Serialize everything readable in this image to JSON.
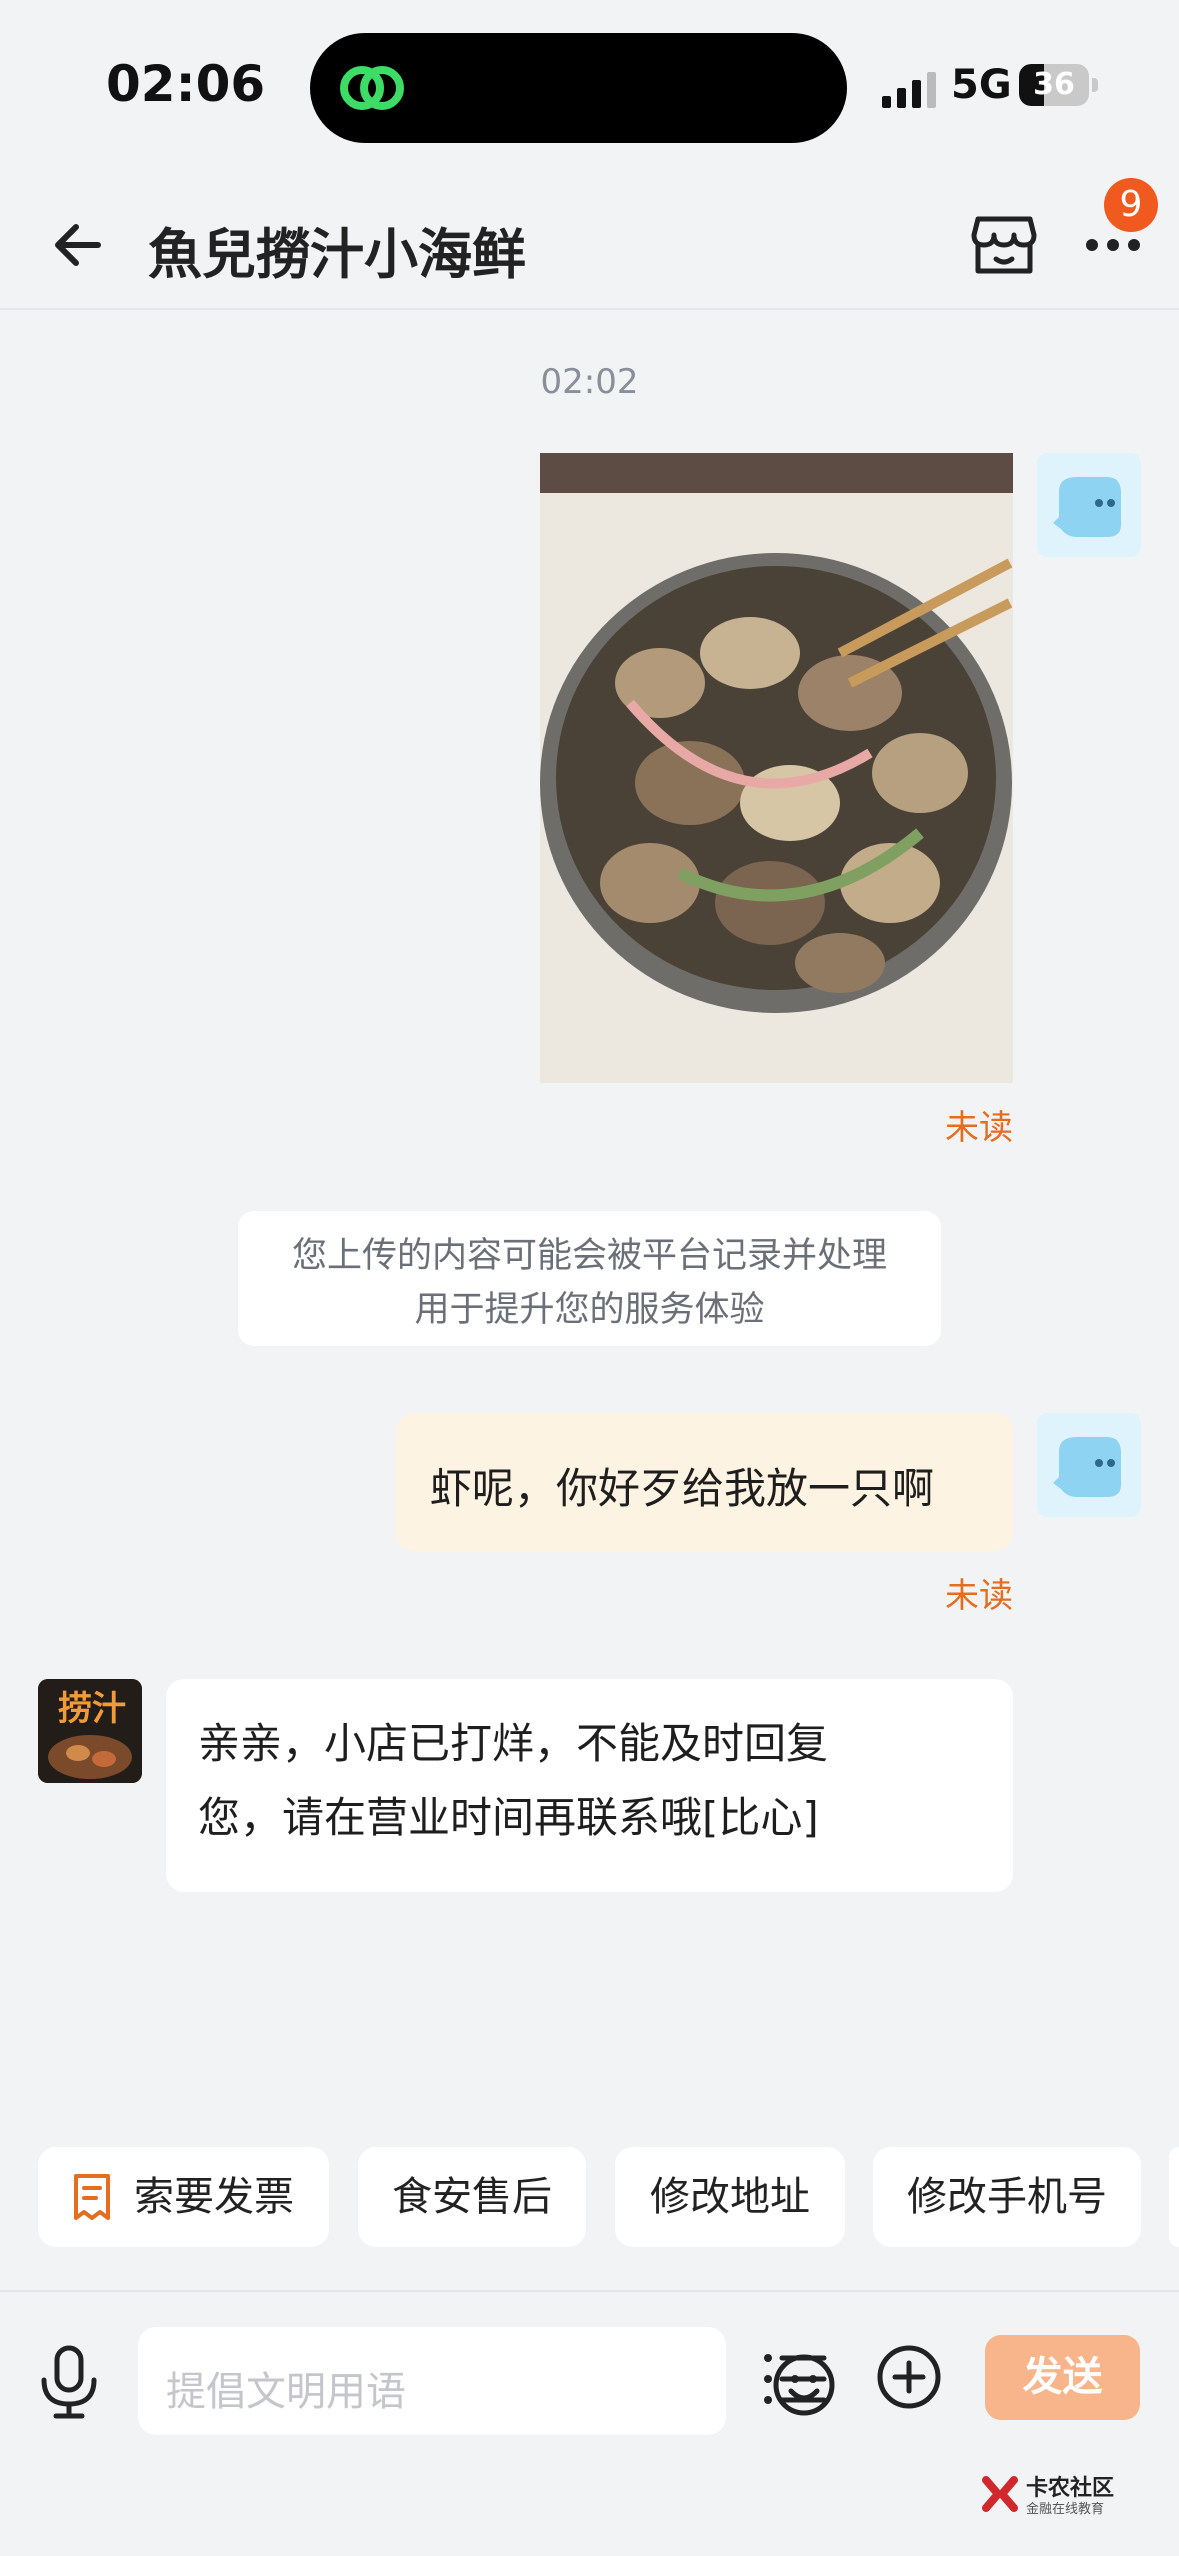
{
  "status_bar": {
    "time": "02:06",
    "network": "5G",
    "battery": "36",
    "battery_level": 0.36
  },
  "header": {
    "title": "魚兒撈汁小海鲜",
    "badge_count": "9"
  },
  "chat": {
    "timestamp": "02:02",
    "unread_label_1": "未读",
    "notice_line1": "您上传的内容可能会被平台记录并处理",
    "notice_line2": "用于提升您的服务体验",
    "my_message": "虾呢，你好歹给我放一只啊",
    "unread_label_2": "未读",
    "shop_avatar_text": "捞汁",
    "shop_reply_line1": "亲亲，小店已打烊，不能及时回复",
    "shop_reply_line2": "您，请在营业时间再联系哦[比心]"
  },
  "quick_actions": [
    {
      "label": "索要发票",
      "icon": "receipt-icon"
    },
    {
      "label": "食安售后"
    },
    {
      "label": "修改地址"
    },
    {
      "label": "修改手机号"
    }
  ],
  "input": {
    "placeholder": "提倡文明用语",
    "send_label": "发送"
  },
  "watermark": {
    "title": "卡农社区",
    "subtitle": "金融在线教育"
  },
  "colors": {
    "accent": "#e56d1f",
    "send_disabled": "#f8b48a",
    "badge": "#f05a1e",
    "bubble_me": "#fdf3e3",
    "background": "#f2f3f5"
  }
}
